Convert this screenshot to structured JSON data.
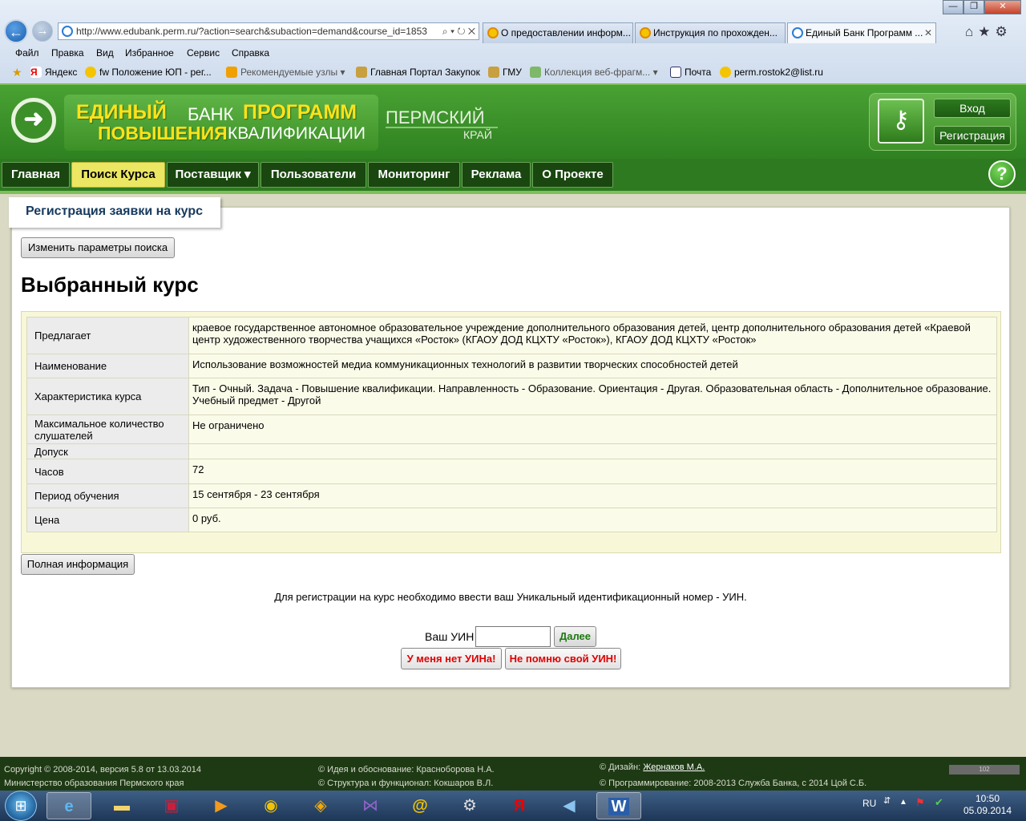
{
  "window": {
    "minimize": "—",
    "maximize": "❐",
    "close": "✕"
  },
  "browser": {
    "address": "http://www.edubank.perm.ru/?action=search&subaction=demand&course_id=1853",
    "tabs": [
      {
        "label": "О предоставлении информ..."
      },
      {
        "label": "Инструкция по прохожден..."
      },
      {
        "label": "Единый Банк Программ ...",
        "active": true
      }
    ],
    "menu": [
      "Файл",
      "Правка",
      "Вид",
      "Избранное",
      "Сервис",
      "Справка"
    ],
    "favorites": [
      {
        "label": "Яндекс",
        "icon": "yandex-icon"
      },
      {
        "label": "fw Положение ЮП - рег...",
        "icon": "mail-at-icon"
      },
      {
        "label": "Рекомендуемые узлы ▾",
        "icon": "bing-icon"
      },
      {
        "label": "Главная Портал Закупок",
        "icon": "eagle-icon"
      },
      {
        "label": "ГМУ",
        "icon": "eagle-icon"
      },
      {
        "label": "Коллекция веб-фрагм... ▾",
        "icon": "webslice-icon"
      },
      {
        "label": "Почта",
        "icon": "mail-icon"
      },
      {
        "label": "perm.rostok2@list.ru",
        "icon": "mail-at-icon"
      }
    ]
  },
  "site": {
    "logo": {
      "word1": "ЕДИНЫЙ",
      "word2": "БАНК",
      "word3": "ПРОГРАММ",
      "word4": "ПОВЫШЕНИЯ",
      "word5": "КВАЛИФИКАЦИИ"
    },
    "region_line1": "ПЕРМСКИЙ",
    "region_line2": "КРАЙ",
    "login_label": "Вход",
    "register_label": "Регистрация"
  },
  "nav": [
    {
      "label": "Главная"
    },
    {
      "label": "Поиск Курса",
      "active": true
    },
    {
      "label": "Поставщик ▾"
    },
    {
      "label": "Пользователи"
    },
    {
      "label": "Мониторинг"
    },
    {
      "label": "Реклама"
    },
    {
      "label": "О Проекте"
    }
  ],
  "page": {
    "tab_title": "Регистрация заявки на курс",
    "change_params_label": "Изменить параметры поиска",
    "title": "Выбранный курс",
    "course": [
      {
        "label": "Предлагает",
        "value": "краевое государственное автономное образовательное учреждение дополнительного образования детей, центр дополнительного образования детей «Краевой центр художественного творчества учащихся «Росток» (КГАОУ ДОД КЦХТУ «Росток»), КГАОУ ДОД КЦХТУ «Росток»"
      },
      {
        "label": "Наименование",
        "value": "Использование возможностей медиа коммуникационных технологий в развитии творческих способностей детей"
      },
      {
        "label": "Характеристика курса",
        "value": "Тип - Очный. Задача - Повышение квалификации. Направленность - Образование. Ориентация - Другая. Образовательная область - Дополнительное образование. Учебный предмет - Другой"
      },
      {
        "label": "Максимальное количество слушателей",
        "value": "Не ограничено"
      },
      {
        "label": "Допуск",
        "value": ""
      },
      {
        "label": "Часов",
        "value": "72"
      },
      {
        "label": "Период обучения",
        "value": "15 сентября - 23 сентября"
      },
      {
        "label": "Цена",
        "value": "0 руб."
      }
    ],
    "full_info_label": "Полная информация",
    "uin_note": "Для регистрации на курс необходимо ввести ваш Уникальный идентификационный номер - УИН.",
    "uin_label": "Ваш УИН",
    "uin_value": "",
    "next_label": "Далее",
    "no_uin_label": "У меня нет УИНа!",
    "forgot_uin_label": "Не помню свой УИН!"
  },
  "footer": {
    "copyright": "Copyright © 2008-2014, версия 5.8 от 13.03.2014",
    "ministry": "Министерство образования Пермского края",
    "idea": "© Идея и обоснование: Красноборова Н.А.",
    "structure": "© Структура и функционал: Кокшаров В.Л.",
    "design_prefix": "© Дизайн:",
    "design_name": "Жернаков М.А.",
    "programming": "© Программирование: 2008-2013 Служба Банка, с 2014 Цой С.Б.",
    "counter": "102"
  },
  "taskbar": {
    "lang": "RU",
    "time": "10:50",
    "date": "05.09.2014"
  },
  "colors": {
    "header_green": "#3c9026",
    "logo_yellow": "#ffe21a",
    "nav_dark": "#19470f",
    "nav_active": "#ece763",
    "alert_red": "#e00000"
  }
}
